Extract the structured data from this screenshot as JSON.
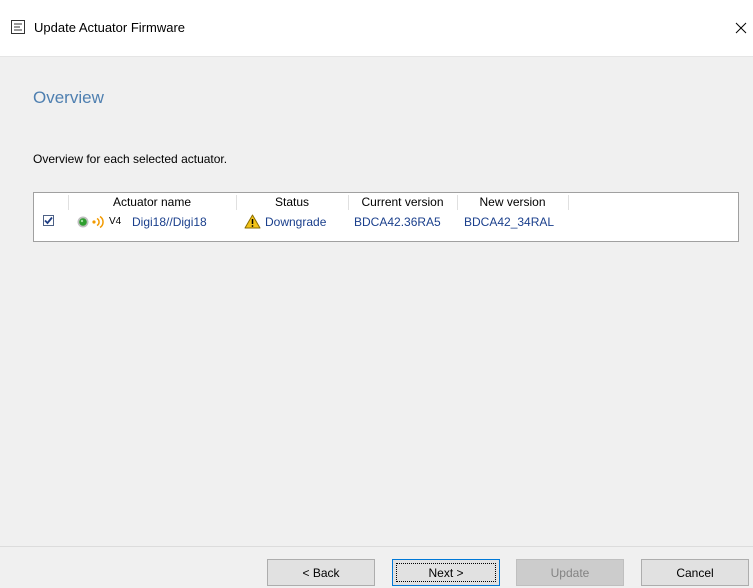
{
  "window": {
    "title": "Update Actuator Firmware",
    "close_glyph": "✕"
  },
  "page": {
    "heading": "Overview",
    "description": "Overview for each selected actuator."
  },
  "table": {
    "columns": [
      "Actuator name",
      "Status",
      "Current version",
      "New version"
    ],
    "rows": [
      {
        "checked": true,
        "protocol": "V4",
        "name": "Digi18//Digi18",
        "status": "Downgrade",
        "current_version": "BDCA42.36RA5",
        "new_version": "BDCA42_34RAL"
      }
    ]
  },
  "buttons": {
    "back": "< Back",
    "next": "Next >",
    "update": "Update",
    "cancel": "Cancel"
  },
  "colors": {
    "heading": "#4e7fb0",
    "link": "#1a3f8c",
    "warning": "#f3c318",
    "status_green": "#2e9e2e",
    "signal_orange": "#f29a00"
  },
  "icons": [
    "app-icon",
    "close-icon",
    "checkbox-check-icon",
    "online-status-icon",
    "signal-icon",
    "warning-icon"
  ]
}
